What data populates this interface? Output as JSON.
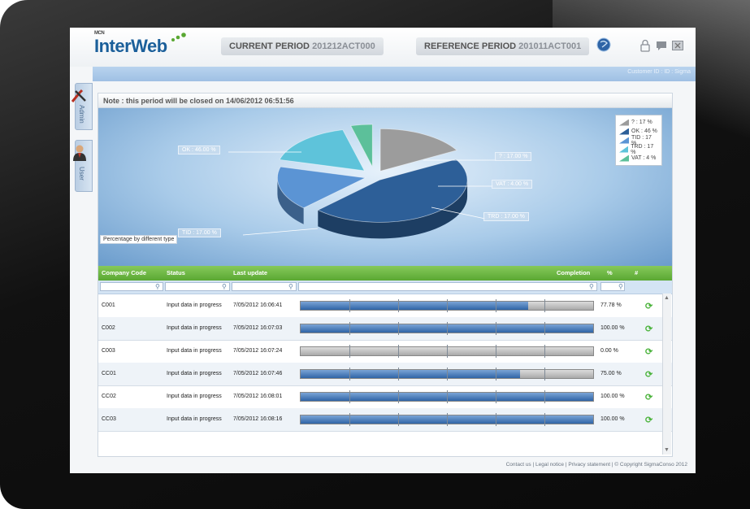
{
  "header": {
    "logo_prefix": "MCN",
    "logo_text": "InterWeb",
    "current_period_label": "CURRENT PERIOD",
    "current_period_value": "201212ACT000",
    "reference_period_label": "REFERENCE PERIOD",
    "reference_period_value": "201011ACT001",
    "customer_text": "Customer ID : ID : Sigma"
  },
  "sidebar": {
    "items": [
      {
        "label": "Admin",
        "icon": "tools-icon"
      },
      {
        "label": "User",
        "icon": "user-icon"
      }
    ]
  },
  "note": "Note : this period will be closed on 14/06/2012 06:51:56",
  "chart_data": {
    "type": "pie",
    "title": "Percentage by different type",
    "slices": [
      {
        "label": "?",
        "value": 17,
        "color": "#9c9c9c",
        "callout": "? : 17.00 %"
      },
      {
        "label": "OK",
        "value": 46,
        "color": "#2d5f98",
        "callout": "OK : 46.00 %"
      },
      {
        "label": "TID",
        "value": 17,
        "color": "#5b94d4",
        "callout": "TID : 17.00 %"
      },
      {
        "label": "TRD",
        "value": 17,
        "color": "#5ec3da",
        "callout": "TRD : 17.00 %"
      },
      {
        "label": "VAT",
        "value": 4,
        "color": "#5cc09a",
        "callout": "VAT : 4.00 %"
      }
    ],
    "legend": [
      "? : 17 %",
      "OK : 46 %",
      "TID : 17 %",
      "TRD : 17 %",
      "VAT : 4 %"
    ],
    "legend_position": "top-right"
  },
  "table": {
    "headers": [
      "Company Code",
      "Status",
      "Last update",
      "Completion",
      "%",
      "#"
    ],
    "rows": [
      {
        "code": "C001",
        "status": "Input data in progress",
        "updated": "7/05/2012 16:06:41",
        "completion": 0.7778,
        "pct": "77.78 %"
      },
      {
        "code": "C002",
        "status": "Input data in progress",
        "updated": "7/05/2012 16:07:03",
        "completion": 1.0,
        "pct": "100.00 %"
      },
      {
        "code": "C003",
        "status": "Input data in progress",
        "updated": "7/05/2012 16:07:24",
        "completion": 0.0,
        "pct": "0.00 %"
      },
      {
        "code": "CC01",
        "status": "Input data in progress",
        "updated": "7/05/2012 16:07:46",
        "completion": 0.75,
        "pct": "75.00 %"
      },
      {
        "code": "CC02",
        "status": "Input data in progress",
        "updated": "7/05/2012 16:08:01",
        "completion": 1.0,
        "pct": "100.00 %"
      },
      {
        "code": "CC03",
        "status": "Input data in progress",
        "updated": "7/05/2012 16:08:16",
        "completion": 1.0,
        "pct": "100.00 %"
      }
    ]
  },
  "footer": "Contact us | Legal notice | Privacy statement | © Copyright SigmaConso 2012",
  "colors": {
    "accent_green": "#5aa833",
    "accent_blue": "#2f64a6",
    "refresh": "#4bb33c"
  }
}
